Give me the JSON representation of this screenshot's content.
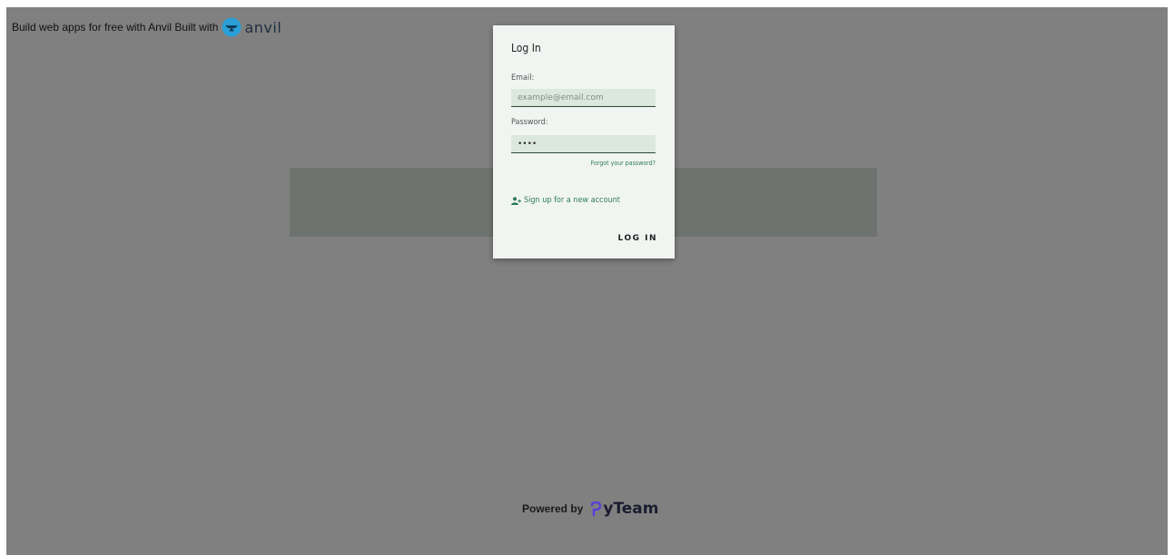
{
  "banner": {
    "text": "Build web apps for free with Anvil Built with",
    "logo_word": "anvil"
  },
  "login": {
    "title": "Log In",
    "email_label": "Email:",
    "email_placeholder": "example@email.com",
    "password_label": "Password:",
    "password_value": "••••",
    "forgot_label": "Forgot your password?",
    "signup_label": "Sign up for a new account",
    "login_button_label": "LOG IN"
  },
  "footer": {
    "powered_label": "Powered by",
    "brand_word": "yTeam"
  },
  "colors": {
    "overlay": "#808080",
    "dialog": "#f1f5f2",
    "input_bg": "#dde8dc",
    "link": "#2f7a5b",
    "anvil_blue": "#2a9fd8",
    "pyteam_purple": "#5b3fd6"
  },
  "icons": {
    "anvil": "anvil-logo-icon",
    "signup": "user-plus-icon",
    "pyteam": "pyteam-logo-icon"
  }
}
